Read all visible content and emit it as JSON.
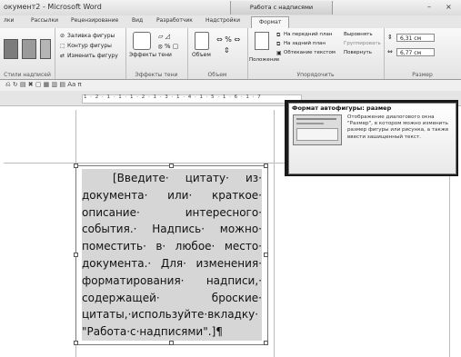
{
  "window": {
    "title": "окумент2 - Microsoft Word",
    "context_tab": "Работа с надписями",
    "minimize": "–",
    "close": "×"
  },
  "tabs": [
    "лки",
    "Рассылки",
    "Рецензирование",
    "Вид",
    "Разработчик",
    "Надстройки",
    "Формат"
  ],
  "ribbon": {
    "styles_group": {
      "label": "Стили надписей"
    },
    "shape_styles": {
      "fill": "Заливка фигуры",
      "outline": "Контур фигуры",
      "change": "Изменить фигуру"
    },
    "shadow_group": {
      "label": "Эффекты тени",
      "button": "Эффекты тени"
    },
    "volume_group": {
      "label": "Объем",
      "button": "Объем"
    },
    "arrange_group": {
      "label": "Упорядочить",
      "position": "Положение",
      "front": "На передний план",
      "back": "На задний план",
      "wrap": "Обтекание текстом",
      "align": "Выровнять",
      "group": "Группировать",
      "rotate": "Повернуть"
    },
    "size_group": {
      "label": "Размер",
      "height": "6,31 см",
      "width": "6,77 см"
    }
  },
  "ruler": {
    "numbers": "1 · 2 · 1 · 1 · 1 · 2 · 1 · 3 · 1 · 4 · 1 · 5 · 1 · 6 · 1 · 7"
  },
  "textbox": {
    "lines": [
      "[Введите· цитату· из·",
      "документа· или· краткое·",
      "описание· интересного·",
      "события.· Надпись· можно·",
      "поместить· в· любое· место·",
      "документа.· Для· изменения·",
      "форматирования· надписи,·",
      "содержащей· броские·",
      "цитаты,·используйте·вкладку·",
      "\"Работа·с·надписями\".]¶"
    ]
  },
  "tooltip": {
    "title": "Формат автофигуры: размер",
    "body": "Отображение диалогового окна \"Размер\", в котором можно изменить размер фигуры или рисунка, а также ввести зашищенный текст."
  }
}
